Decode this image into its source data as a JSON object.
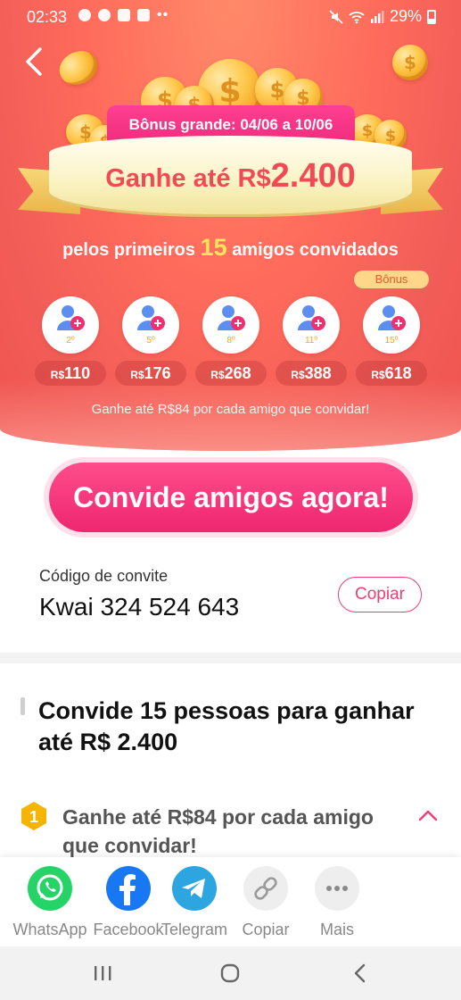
{
  "status_bar": {
    "time": "02:33",
    "battery": "29%"
  },
  "hero": {
    "bonus_pill": "Bônus grande: 04/06 a 10/06",
    "banner_prefix": "Ganhe até R$",
    "banner_amount": "2.400",
    "subtitle_pre": "pelos primeiros",
    "subtitle_num": "15",
    "subtitle_post": "amigos convidados",
    "bonus_tag": "Bônus",
    "milestones": [
      {
        "index": "2º",
        "currency": "R$",
        "value": "110"
      },
      {
        "index": "5º",
        "currency": "R$",
        "value": "176"
      },
      {
        "index": "8º",
        "currency": "R$",
        "value": "268"
      },
      {
        "index": "11º",
        "currency": "R$",
        "value": "388"
      },
      {
        "index": "15º",
        "currency": "R$",
        "value": "618"
      }
    ],
    "note": "Ganhe até R$84 por cada amigo que convidar!"
  },
  "cta": {
    "label": "Convide amigos agora!"
  },
  "invite": {
    "label": "Código de convite",
    "code": "Kwai 324 524 643",
    "copy_label": "Copiar"
  },
  "section": {
    "title": "Convide 15 pessoas para ganhar até R$ 2.400"
  },
  "step": {
    "number": "1",
    "text": "Ganhe até R$84 por cada amigo que convidar!"
  },
  "share": {
    "items": [
      {
        "label": "WhatsApp",
        "color": "#25d366"
      },
      {
        "label": "Facebook",
        "color": "#1877f2"
      },
      {
        "label": "Telegram",
        "color": "#2ca5e0"
      },
      {
        "label": "Copiar",
        "color": "#eeeeee"
      },
      {
        "label": "Mais",
        "color": "#eeeeee"
      }
    ]
  },
  "colors": {
    "accent": "#ee2670",
    "hero": "#f25d58",
    "highlight": "#ffe45c"
  }
}
